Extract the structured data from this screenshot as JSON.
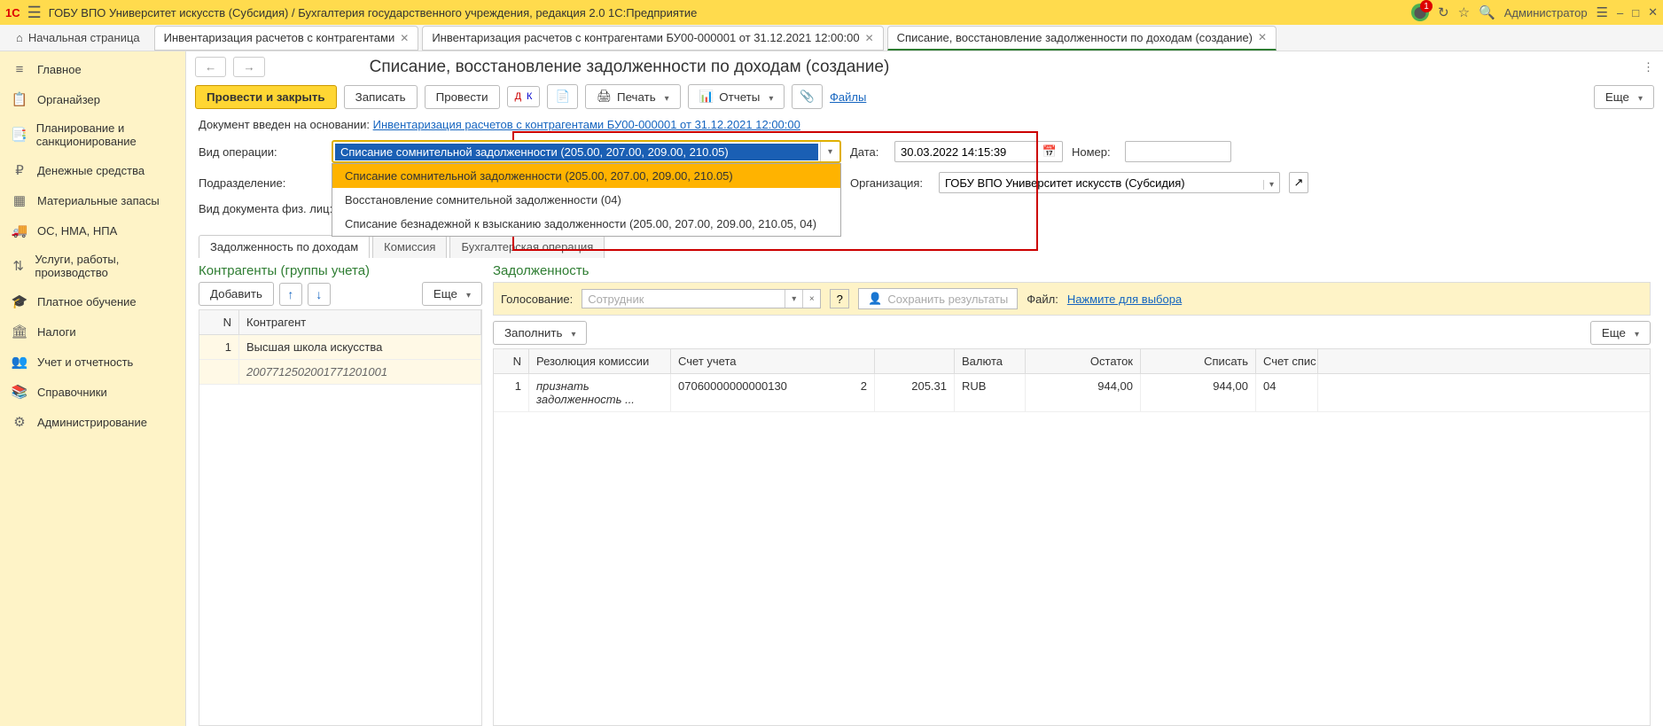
{
  "topbar": {
    "logo": "1C",
    "title": "ГОБУ ВПО Университет искусств (Субсидия) / Бухгалтерия государственного учреждения, редакция 2.0 1С:Предприятие",
    "badge": "1",
    "user": "Администратор"
  },
  "tabs": {
    "home": "Начальная страница",
    "t1": "Инвентаризация расчетов с контрагентами",
    "t2": "Инвентаризация расчетов с контрагентами БУ00-000001 от 31.12.2021 12:00:00",
    "t3": "Списание, восстановление задолженности по доходам (создание)"
  },
  "sidebar": {
    "items": [
      {
        "icon": "≡",
        "label": "Главное"
      },
      {
        "icon": "📋",
        "label": "Органайзер"
      },
      {
        "icon": "📑",
        "label": "Планирование и санкционирование"
      },
      {
        "icon": "₽",
        "label": "Денежные средства"
      },
      {
        "icon": "▦",
        "label": "Материальные запасы"
      },
      {
        "icon": "🚚",
        "label": "ОС, НМА, НПА"
      },
      {
        "icon": "⇅",
        "label": "Услуги, работы, производство"
      },
      {
        "icon": "🎓",
        "label": "Платное обучение"
      },
      {
        "icon": "🏛",
        "label": "Налоги"
      },
      {
        "icon": "👥",
        "label": "Учет и отчетность"
      },
      {
        "icon": "📚",
        "label": "Справочники"
      },
      {
        "icon": "⚙",
        "label": "Администрирование"
      }
    ]
  },
  "page": {
    "title": "Списание, восстановление задолженности по доходам (создание)",
    "btn_post_close": "Провести и закрыть",
    "btn_save": "Записать",
    "btn_post": "Провести",
    "btn_print": "Печать",
    "btn_reports": "Отчеты",
    "files_link": "Файлы",
    "btn_more": "Еще"
  },
  "info": {
    "prefix": "Документ введен на основании:",
    "link": "Инвентаризация расчетов с контрагентами БУ00-000001 от 31.12.2021 12:00:00"
  },
  "form": {
    "lbl_op": "Вид операции:",
    "op_selected": "Списание сомнительной задолженности (205.00, 207.00, 209.00, 210.05)",
    "op_options": [
      "Списание сомнительной задолженности (205.00, 207.00, 209.00, 210.05)",
      "Восстановление сомнительной задолженности (04)",
      "Списание безнадежной к взысканию задолженности (205.00, 207.00, 209.00, 210.05, 04)"
    ],
    "lbl_date": "Дата:",
    "date": "30.03.2022 14:15:39",
    "lbl_num": "Номер:",
    "lbl_dept": "Подразделение:",
    "lbl_org": "Организация:",
    "org": "ГОБУ ВПО Университет искусств (Субсидия)",
    "lbl_docfiz": "Вид документа физ. лиц:"
  },
  "doctabs": {
    "t1": "Задолженность по доходам",
    "t2": "Комиссия",
    "t3": "Бухгалтерская операция"
  },
  "left": {
    "title": "Контрагенты (группы учета)",
    "btn_add": "Добавить",
    "btn_more": "Еще",
    "h_n": "N",
    "h_name": "Контрагент",
    "row_n": "1",
    "row_name": "Высшая школа искусства",
    "row_code": "2007712502001771201001"
  },
  "right": {
    "title": "Задолженность",
    "vote_lbl": "Голосование:",
    "vote_ph": "Сотрудник",
    "save_res": "Сохранить результаты",
    "file_lbl": "Файл:",
    "file_link": "Нажмите для выбора",
    "btn_fill": "Заполнить",
    "btn_more": "Еще",
    "h_n": "N",
    "h_res": "Резолюция комиссии",
    "h_sch": "Счет учета",
    "h_val": "Валюта",
    "h_ost": "Остаток",
    "h_spi": "Списать",
    "h_schs": "Счет спис",
    "r_n": "1",
    "r_res": "признать задолженность ...",
    "r_sch": "07060000000000130",
    "r_schn2": "2",
    "r_schn": "205.31",
    "r_val": "RUB",
    "r_ost": "944,00",
    "r_spi": "944,00",
    "r_schs": "04"
  }
}
